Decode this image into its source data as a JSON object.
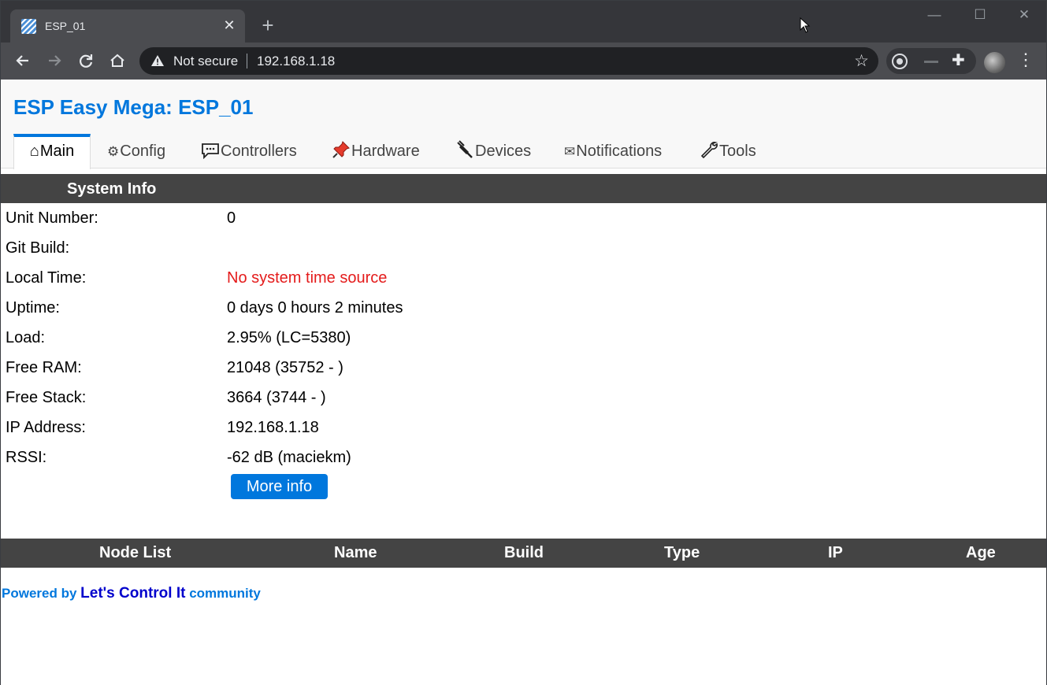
{
  "browser": {
    "tab_title": "ESP_01",
    "tab_close": "✕",
    "new_tab": "+",
    "security_label": "Not secure",
    "url": "192.168.1.18",
    "window_controls": {
      "minimize": "—",
      "maximize": "☐",
      "close": "✕"
    }
  },
  "page": {
    "title": "ESP Easy Mega: ESP_01",
    "menu": [
      {
        "icon": "⌂",
        "label": "Main"
      },
      {
        "icon": "⚙",
        "label": "Config"
      },
      {
        "icon": "💬",
        "label": "Controllers"
      },
      {
        "icon": "📌",
        "label": "Hardware"
      },
      {
        "icon": "🔌",
        "label": "Devices"
      },
      {
        "icon": "✉",
        "label": "Notifications"
      },
      {
        "icon": "🔧",
        "label": "Tools"
      }
    ],
    "system_info": {
      "header": "System Info",
      "rows": [
        {
          "label": "Unit Number:",
          "value": "0"
        },
        {
          "label": "Git Build:",
          "value": ""
        },
        {
          "label": "Local Time:",
          "value": "No system time source"
        },
        {
          "label": "Uptime:",
          "value": "0 days 0 hours 2 minutes"
        },
        {
          "label": "Load:",
          "value": "2.95% (LC=5380)"
        },
        {
          "label": "Free RAM:",
          "value": "21048 (35752 - )"
        },
        {
          "label": "Free Stack:",
          "value": "3664 (3744 - )"
        },
        {
          "label": "IP Address:",
          "value": "192.168.1.18"
        },
        {
          "label": "RSSI:",
          "value": "-62 dB (maciekm)"
        }
      ],
      "more_info_button": "More info"
    },
    "node_list": {
      "columns": [
        "Node List",
        "Name",
        "Build",
        "Type",
        "IP",
        "Age"
      ]
    },
    "footer": {
      "prefix": "Powered by",
      "link": "Let's Control It",
      "suffix": "community"
    },
    "colors": {
      "accent": "#0077dd",
      "header_bg": "#444444",
      "warning_text": "#e41b1b"
    }
  }
}
